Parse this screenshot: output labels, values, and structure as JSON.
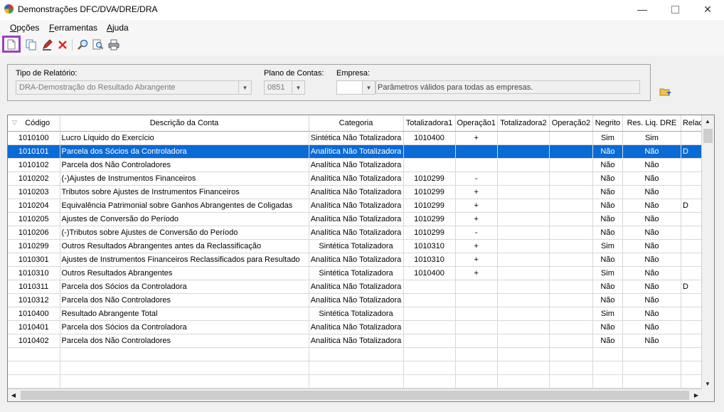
{
  "window": {
    "title": "Demonstrações DFC/DVA/DRE/DRA"
  },
  "menu": [
    {
      "label": "Opções",
      "underline": "O",
      "rest": "pções"
    },
    {
      "label": "Ferramentas",
      "underline": "F",
      "rest": "erramentas"
    },
    {
      "label": "Ajuda",
      "underline": "A",
      "rest": "juda"
    }
  ],
  "toolbar": {
    "icons": [
      "new-document-icon",
      "copy-icon",
      "edit-pencil-icon",
      "delete-icon",
      "search-icon",
      "zoom-search-icon",
      "print-icon"
    ]
  },
  "filters": {
    "tipo_label": "Tipo de Relatório:",
    "tipo_value": "DRA-Demostração do Resultado Abrangente",
    "plano_label": "Plano de Contas:",
    "plano_value": "0851",
    "empresa_label": "Empresa:",
    "empresa_value": "",
    "note": "Parâmetros válidos para todas as empresas."
  },
  "grid": {
    "columns": [
      "Código",
      "Descrição da Conta",
      "Categoria",
      "Totalizadora1",
      "Operação1",
      "Totalizadora2",
      "Operação2",
      "Negrito",
      "Res. Liq. DRE",
      "Relac"
    ],
    "rows": [
      [
        "1010100",
        "Lucro Líquido do Exercício",
        "Sintética Não Totalizadora",
        "1010400",
        "+",
        "",
        "",
        "Sim",
        "Sim",
        ""
      ],
      [
        "1010101",
        "Parcela dos Sócios da Controladora",
        "Analítica Não Totalizadora",
        "",
        "",
        "",
        "",
        "Não",
        "Não",
        "D"
      ],
      [
        "1010102",
        "Parcela dos Não Controladores",
        "Analítica Não Totalizadora",
        "",
        "",
        "",
        "",
        "Não",
        "Não",
        ""
      ],
      [
        "1010202",
        "(-)Ajustes de Instrumentos Financeiros",
        "Analítica Não Totalizadora",
        "1010299",
        "-",
        "",
        "",
        "Não",
        "Não",
        ""
      ],
      [
        "1010203",
        "Tributos sobre Ajustes de Instrumentos Financeiros",
        "Analítica Não Totalizadora",
        "1010299",
        "+",
        "",
        "",
        "Não",
        "Não",
        ""
      ],
      [
        "1010204",
        "Equivalência Patrimonial sobre Ganhos Abrangentes de Coligadas",
        "Analítica Não Totalizadora",
        "1010299",
        "+",
        "",
        "",
        "Não",
        "Não",
        "D"
      ],
      [
        "1010205",
        "Ajustes de Conversão do Período",
        "Analítica Não Totalizadora",
        "1010299",
        "+",
        "",
        "",
        "Não",
        "Não",
        ""
      ],
      [
        "1010206",
        "(-)Tributos sobre Ajustes de Conversão do Período",
        "Analítica Não Totalizadora",
        "1010299",
        "-",
        "",
        "",
        "Não",
        "Não",
        ""
      ],
      [
        "1010299",
        "Outros Resultados Abrangentes antes da Reclassificação",
        "Sintética Totalizadora",
        "1010310",
        "+",
        "",
        "",
        "Sim",
        "Não",
        ""
      ],
      [
        "1010301",
        "Ajustes de Instrumentos Financeiros Reclassificados para Resultado",
        "Analítica Não Totalizadora",
        "1010310",
        "+",
        "",
        "",
        "Não",
        "Não",
        ""
      ],
      [
        "1010310",
        "Outros Resultados Abrangentes",
        "Sintética Totalizadora",
        "1010400",
        "+",
        "",
        "",
        "Sim",
        "Não",
        ""
      ],
      [
        "1010311",
        "Parcela dos Sócios da Controladora",
        "Analítica Não Totalizadora",
        "",
        "",
        "",
        "",
        "Não",
        "Não",
        "D"
      ],
      [
        "1010312",
        "Parcela dos Não Controladores",
        "Analítica Não Totalizadora",
        "",
        "",
        "",
        "",
        "Não",
        "Não",
        ""
      ],
      [
        "1010400",
        "Resultado Abrangente Total",
        "Sintética Totalizadora",
        "",
        "",
        "",
        "",
        "Sim",
        "Não",
        ""
      ],
      [
        "1010401",
        "Parcela dos Sócios da Controladora",
        "Analítica Não Totalizadora",
        "",
        "",
        "",
        "",
        "Não",
        "Não",
        ""
      ],
      [
        "1010402",
        "Parcela dos Não Controladores",
        "Analítica Não Totalizadora",
        "",
        "",
        "",
        "",
        "Não",
        "Não",
        ""
      ]
    ],
    "selected_row": 1,
    "empty_rows": 3
  },
  "colors": {
    "selection": "#0a6ad6",
    "highlight_border": "#9b3fbf"
  }
}
